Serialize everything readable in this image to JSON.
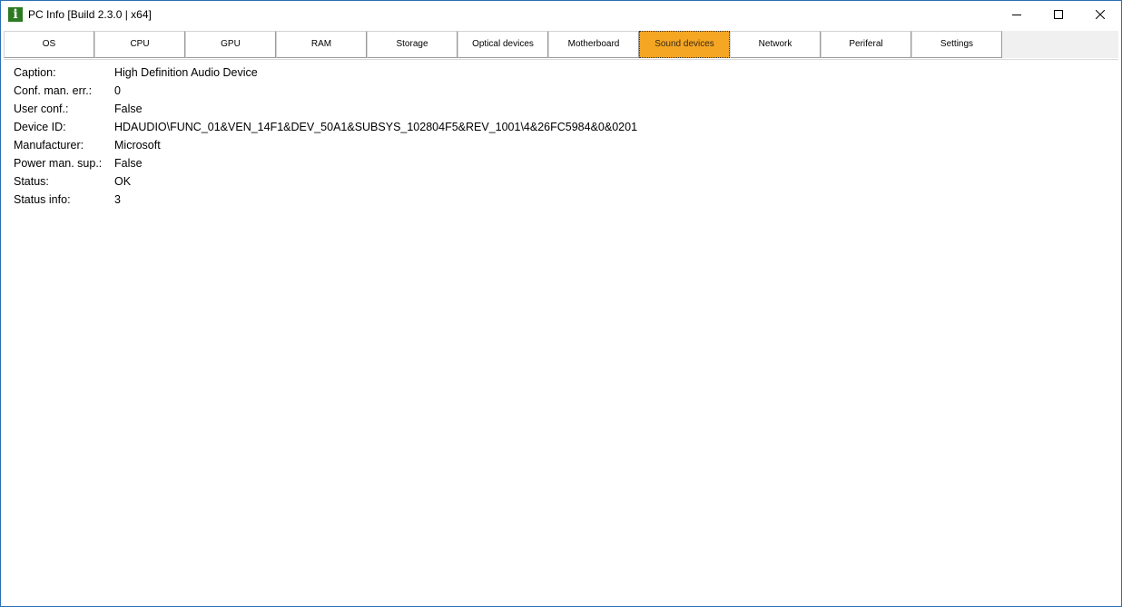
{
  "window": {
    "title": "PC Info [Build 2.3.0 | x64]",
    "icon_glyph": "i",
    "icon_name": "info-icon",
    "accent_color": "#f5a623"
  },
  "tabs": [
    {
      "label": "OS",
      "active": false
    },
    {
      "label": "CPU",
      "active": false
    },
    {
      "label": "GPU",
      "active": false
    },
    {
      "label": "RAM",
      "active": false
    },
    {
      "label": "Storage",
      "active": false
    },
    {
      "label": "Optical devices",
      "active": false
    },
    {
      "label": "Motherboard",
      "active": false
    },
    {
      "label": "Sound devices",
      "active": true
    },
    {
      "label": "Network",
      "active": false
    },
    {
      "label": "Periferal",
      "active": false
    },
    {
      "label": "Settings",
      "active": false
    }
  ],
  "properties": [
    {
      "label": "Caption:",
      "value": "High Definition Audio Device"
    },
    {
      "label": "Conf. man. err.:",
      "value": "0"
    },
    {
      "label": "User conf.:",
      "value": "False"
    },
    {
      "label": "Device ID:",
      "value": "HDAUDIO\\FUNC_01&VEN_14F1&DEV_50A1&SUBSYS_102804F5&REV_1001\\4&26FC5984&0&0201"
    },
    {
      "label": "Manufacturer:",
      "value": "Microsoft"
    },
    {
      "label": "Power man. sup.:",
      "value": "False"
    },
    {
      "label": "Status:",
      "value": "OK"
    },
    {
      "label": "Status info:",
      "value": "3"
    }
  ]
}
